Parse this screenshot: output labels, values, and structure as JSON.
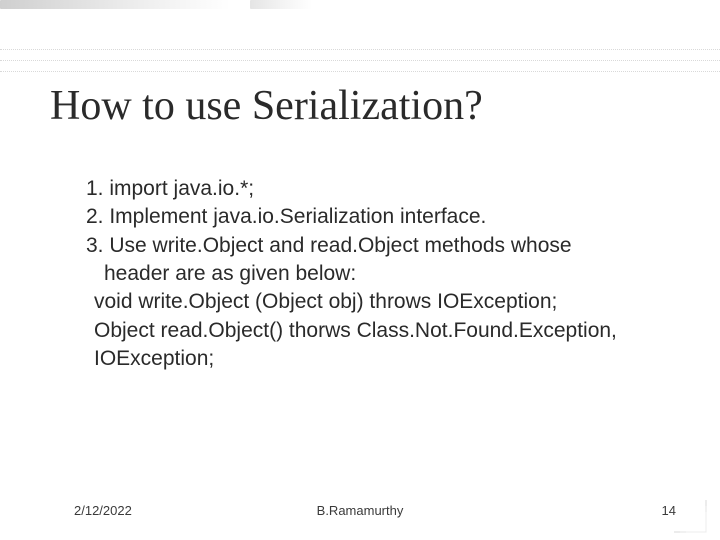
{
  "title": "How to use Serialization?",
  "body": {
    "l1": "1. import java.io.*;",
    "l2": "2. Implement java.io.Serialization interface.",
    "l3": "3. Use write.Object and read.Object methods whose",
    "l3b": "header are as given below:",
    "l4": "void write.Object (Object obj) throws IOException;",
    "l5": "Object read.Object() thorws Class.Not.Found.Exception,",
    "l5b": "IOException;"
  },
  "footer": {
    "date": "2/12/2022",
    "author": "B.Ramamurthy",
    "page": "14"
  }
}
